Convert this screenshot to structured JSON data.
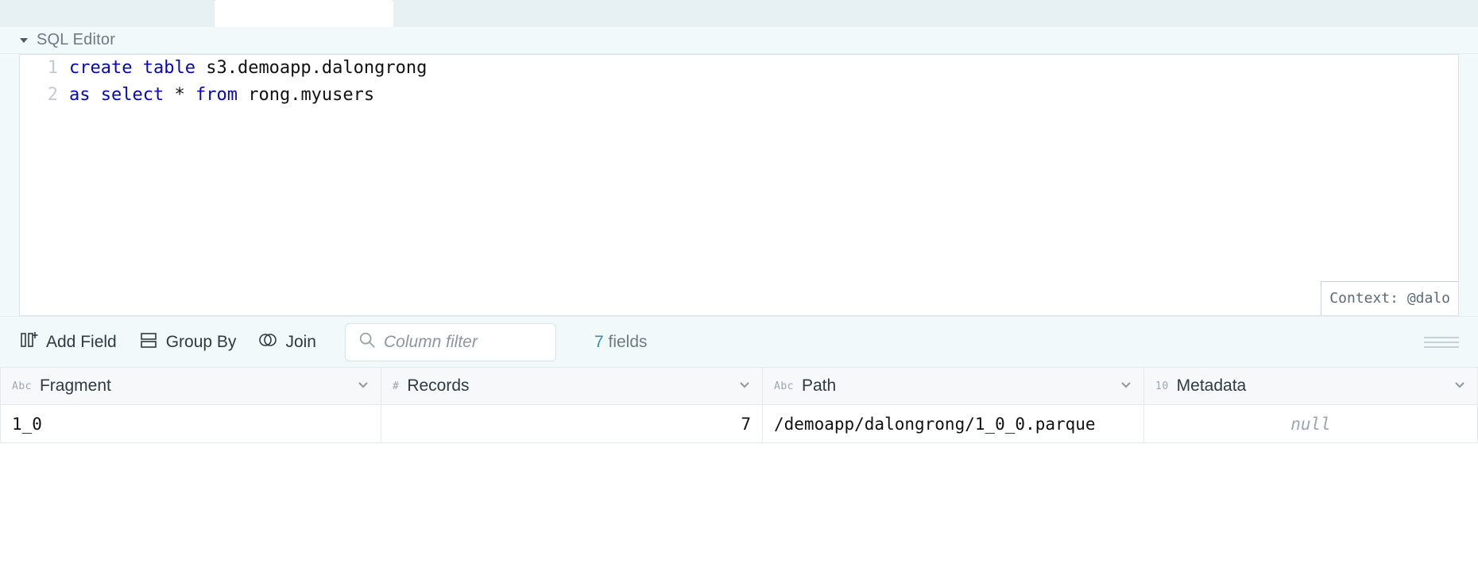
{
  "section": {
    "title": "SQL Editor"
  },
  "editor": {
    "lines": [
      {
        "n": "1",
        "pre1": "",
        "kw1": "create",
        "mid1": " ",
        "kw2": "table",
        "post": " s3.demoapp.dalongrong"
      },
      {
        "n": "2",
        "pre1": "",
        "kw1": "as",
        "mid1": " ",
        "kw2": "select",
        "mid2": " * ",
        "kw3": "from",
        "post": " rong.myusers"
      }
    ],
    "context_label": "Context: @dalo"
  },
  "toolbar": {
    "add_field": "Add Field",
    "group_by": "Group By",
    "join": "Join",
    "filter_placeholder": "Column filter",
    "fields_count": "7",
    "fields_word": "fields"
  },
  "columns": [
    {
      "type": "Abc",
      "label": "Fragment"
    },
    {
      "type": "#",
      "label": "Records"
    },
    {
      "type": "Abc",
      "label": "Path"
    },
    {
      "type": "10",
      "label": "Metadata"
    }
  ],
  "rows": [
    {
      "fragment": "1_0",
      "records": "7",
      "path": "/demoapp/dalongrong/1_0_0.parque",
      "metadata": "null"
    }
  ]
}
